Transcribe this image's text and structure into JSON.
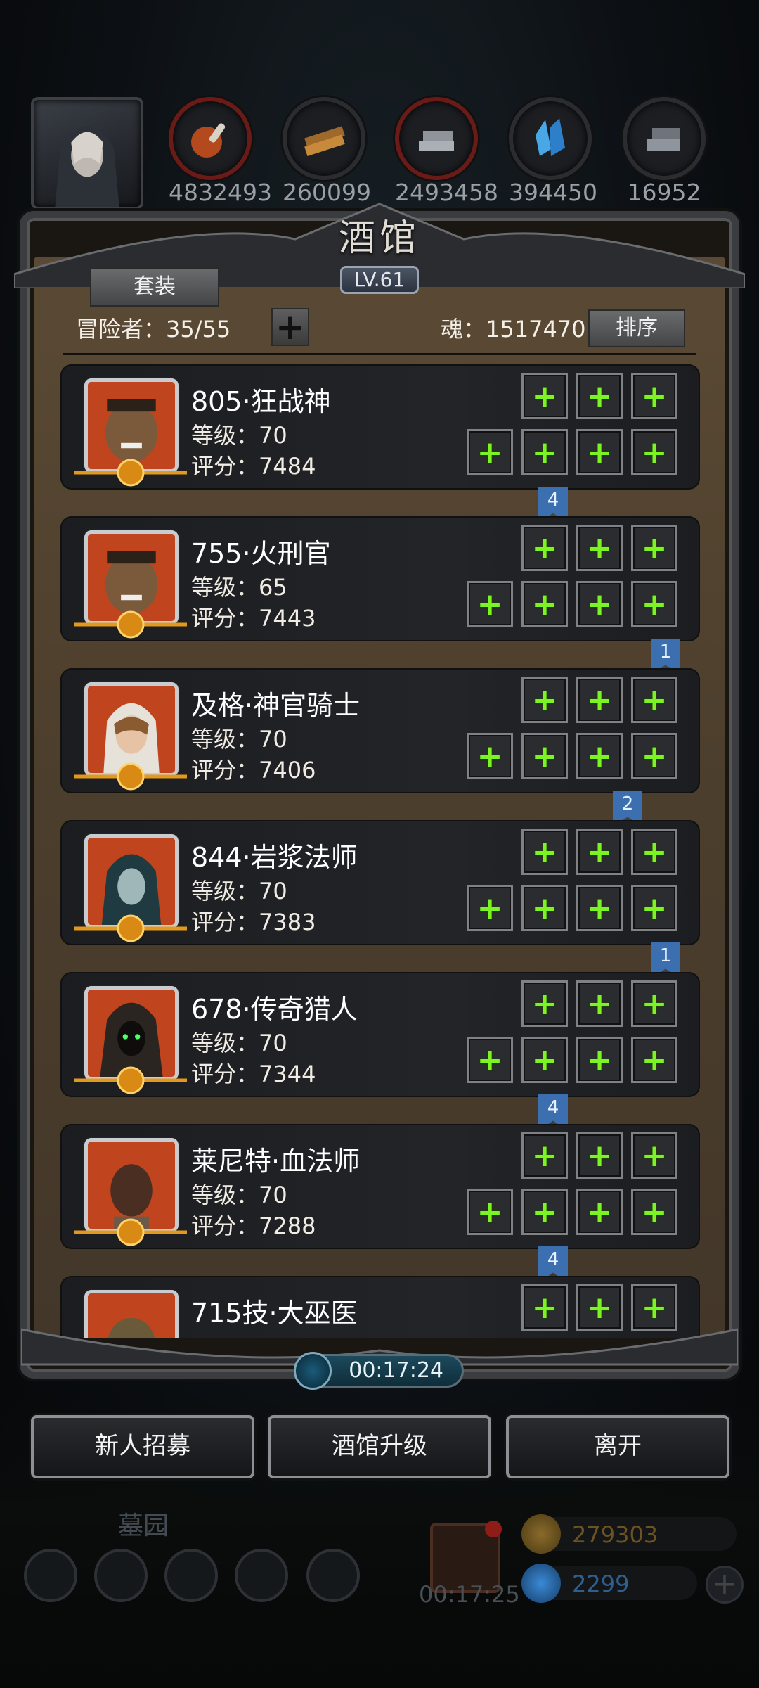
{
  "header": {
    "resources": [
      {
        "icon": "meat-icon",
        "value": "4832493"
      },
      {
        "icon": "wood-icon",
        "value": "260099"
      },
      {
        "icon": "iron-icon",
        "value": "2493458"
      },
      {
        "icon": "crystal-icon",
        "value": "394450"
      },
      {
        "icon": "silver-icon",
        "value": "16952"
      }
    ]
  },
  "panel": {
    "title": "酒馆",
    "level": "LV.61",
    "set_label": "套装",
    "adventurers_label": "冒险者：35/55",
    "soul_label": "魂：1517470",
    "sort_label": "排序"
  },
  "heroes": [
    {
      "name": "805·狂战神",
      "level": "等级：70",
      "score": "评分：7484",
      "marker": "4"
    },
    {
      "name": "755·火刑官",
      "level": "等级：65",
      "score": "评分：7443",
      "marker": "1"
    },
    {
      "name": "及格·神官骑士",
      "level": "等级：70",
      "score": "评分：7406",
      "marker": "2"
    },
    {
      "name": "844·岩浆法师",
      "level": "等级：70",
      "score": "评分：7383",
      "marker": "1"
    },
    {
      "name": "678·传奇猎人",
      "level": "等级：70",
      "score": "评分：7344",
      "marker": "4"
    },
    {
      "name": "莱尼特·血法师",
      "level": "等级：70",
      "score": "评分：7288",
      "marker": "4"
    },
    {
      "name": "715技·大巫医",
      "level": "",
      "score": "",
      "marker": ""
    }
  ],
  "timer": "00:17:24",
  "actions": {
    "recruit": "新人招募",
    "upgrade": "酒馆升级",
    "leave": "离开"
  },
  "hud": {
    "area_label": "墓园",
    "gift_timer": "00:17:25",
    "gold": "279303",
    "gems": "2299"
  },
  "colors": {
    "accent_green": "#7df224",
    "marker_blue": "#3b6fb0",
    "panel_brown": "#4c3e2c"
  }
}
